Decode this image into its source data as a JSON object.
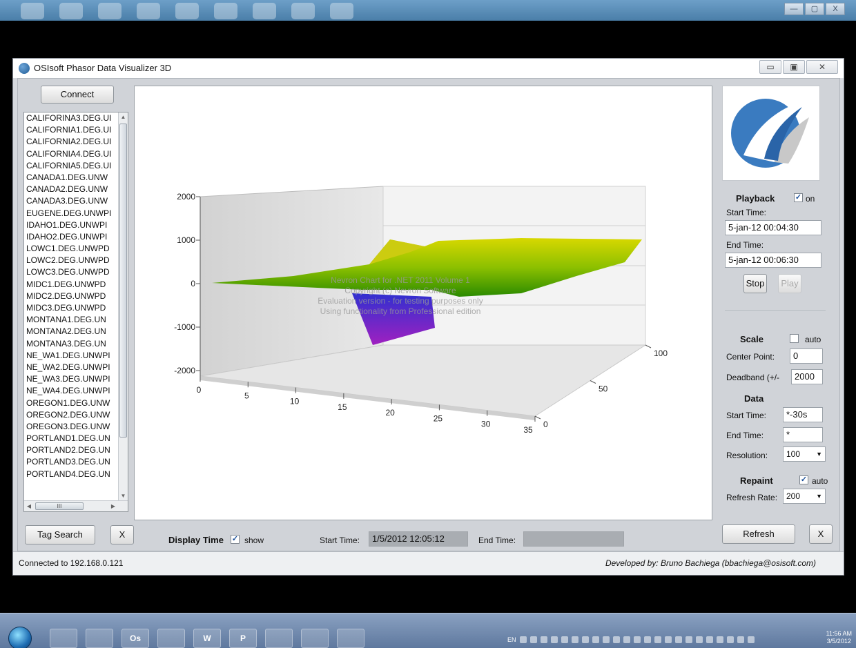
{
  "app": {
    "title": "OSIsoft Phasor Data Visualizer 3D",
    "window_buttons": [
      "▭",
      "▣",
      "✕"
    ]
  },
  "left_panel": {
    "connect_label": "Connect",
    "tags": [
      "CALIFORINA3.DEG.UI",
      "CALIFORNIA1.DEG.UI",
      "CALIFORNIA2.DEG.UI",
      "CALIFORNIA4.DEG.UI",
      "CALIFORNIA5.DEG.UI",
      "CANADA1.DEG.UNW",
      "CANADA2.DEG.UNW",
      "CANADA3.DEG.UNW",
      "EUGENE.DEG.UNWPI",
      "IDAHO1.DEG.UNWPI",
      "IDAHO2.DEG.UNWPI",
      "LOWC1.DEG.UNWPD",
      "LOWC2.DEG.UNWPD",
      "LOWC3.DEG.UNWPD",
      "MIDC1.DEG.UNWPD",
      "MIDC2.DEG.UNWPD",
      "MIDC3.DEG.UNWPD",
      "MONTANA1.DEG.UN",
      "MONTANA2.DEG.UN",
      "MONTANA3.DEG.UN",
      "NE_WA1.DEG.UNWPI",
      "NE_WA2.DEG.UNWPI",
      "NE_WA3.DEG.UNWPI",
      "NE_WA4.DEG.UNWPI",
      "OREGON1.DEG.UNW",
      "OREGON2.DEG.UNW",
      "OREGON3.DEG.UNW",
      "PORTLAND1.DEG.UN",
      "PORTLAND2.DEG.UN",
      "PORTLAND3.DEG.UN",
      "PORTLAND4.DEG.UN"
    ],
    "hscroll_thumb": "III",
    "tag_search_label": "Tag Search",
    "clear_label": "X"
  },
  "chart_data": {
    "type": "3d-surface",
    "y_axis_ticks": [
      2000,
      1000,
      0,
      -1000,
      -2000
    ],
    "ylim": [
      -2000,
      2000
    ],
    "x_axis_ticks": [
      0,
      5,
      10,
      15,
      20,
      25,
      30,
      35
    ],
    "z_axis_ticks": [
      0,
      50,
      100
    ],
    "watermark": [
      "Nevron Chart for .NET 2011 Volume 1",
      "Copyright (c) Nevron Software",
      "Evaluation version - for testing purposes only",
      "Using functionality from Professional edition"
    ],
    "colors": {
      "surface_high": "#d8d800",
      "surface_mid": "#6fb400",
      "surface_low": "#2a8a00",
      "dip_top": "#3030d0",
      "dip_bottom": "#a020c0",
      "wall": "#d9d9d9",
      "floor": "#e6e6e6"
    }
  },
  "right_panel": {
    "playback": {
      "heading": "Playback",
      "on_checked": true,
      "on_label": "on",
      "start_time_label": "Start Time:",
      "start_time_value": "5-jan-12 00:04:30",
      "end_time_label": "End Time:",
      "end_time_value": "5-jan-12 00:06:30",
      "stop_label": "Stop",
      "play_label": "Play"
    },
    "scale": {
      "heading": "Scale",
      "auto_checked": false,
      "auto_label": "auto",
      "center_point_label": "Center Point:",
      "center_point_value": "0",
      "deadband_label": "Deadband (+/-",
      "deadband_value": "2000"
    },
    "data": {
      "heading": "Data",
      "start_time_label": "Start Time:",
      "start_time_value": "*-30s",
      "end_time_label": "End Time:",
      "end_time_value": "*",
      "resolution_label": "Resolution:",
      "resolution_value": "100"
    },
    "repaint": {
      "heading": "Repaint",
      "auto_checked": true,
      "auto_label": "auto",
      "refresh_rate_label": "Refresh Rate:",
      "refresh_rate_value": "200"
    },
    "refresh_label": "Refresh",
    "close_label": "X"
  },
  "bottom_bar": {
    "display_time_label": "Display Time",
    "show_checked": true,
    "show_label": "show",
    "start_time_label": "Start Time:",
    "start_time_value": "1/5/2012 12:05:12",
    "end_time_label": "End Time:",
    "end_time_value": ""
  },
  "status": {
    "connection": "Connected to 192.168.0.121",
    "developer": "Developed by: Bruno Bachiega (bbachiega@osisoft.com)"
  },
  "taskbar": {
    "apps": [
      "",
      "",
      "Os",
      "",
      "W",
      "P",
      "",
      "",
      ""
    ],
    "language": "EN",
    "time": "11:56 AM",
    "date": "3/5/2012"
  },
  "outer_window": {
    "buttons": [
      "—",
      "▢",
      "X"
    ]
  }
}
